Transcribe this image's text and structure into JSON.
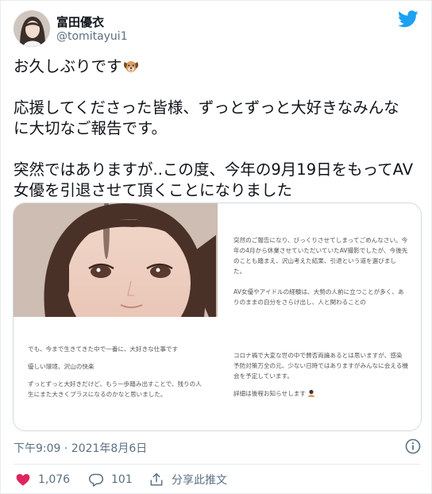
{
  "user": {
    "display_name": "富田優衣",
    "handle": "@tomitayui1"
  },
  "tweet": {
    "line1": "お久しぶりです",
    "line2": "応援してくださった皆様、ずっとずっと大好きなみんな",
    "line3": "に大切なご報告です。",
    "line4": "突然ではありますが..この度、今年の9月19日をもってAV",
    "line5": "女優を引退させて頂くことになりました"
  },
  "media": {
    "top_right": {
      "p1": "突然のご報告になり、びっくりさせてしまってごめんなさい。今年の4月から休業させていただいていたAV撮影でしたが、今後先のことも踏まえ、沢山考えた結果、引退という道を選びました。",
      "p2": "AV女優やアイドルの経験は、大勢の人前に立つことが多く、ありのままの自分をさらけ出し、人と関わることの"
    },
    "bottom_left": {
      "p1": "でも、今まで生きてきた中で一番に、大好きな仕事です",
      "p2": "優しい環境、沢山の快楽",
      "p3": "ずっとずっと大好きだけど、もう一歩踏み出すことで、残りの人生にまた大きくプラスになるのかなと思いました。"
    },
    "bottom_right": {
      "p1": "コロナ禍で大変な世の中で賛否両論あるとは思いますが、感染予防対策万全の元、少ない日時ではありますがみんなに会える機会を予定しています。",
      "p2": "詳細は後程お知らせします"
    }
  },
  "footer": {
    "timestamp": "下午9:09 · 2021年8月6日",
    "like_count": "1,076",
    "reply_count": "101",
    "share_label": "分享此推文"
  },
  "colors": {
    "twitter_blue": "#1da1f2",
    "like_red": "#e0245e",
    "secondary_text": "#5b7083"
  }
}
